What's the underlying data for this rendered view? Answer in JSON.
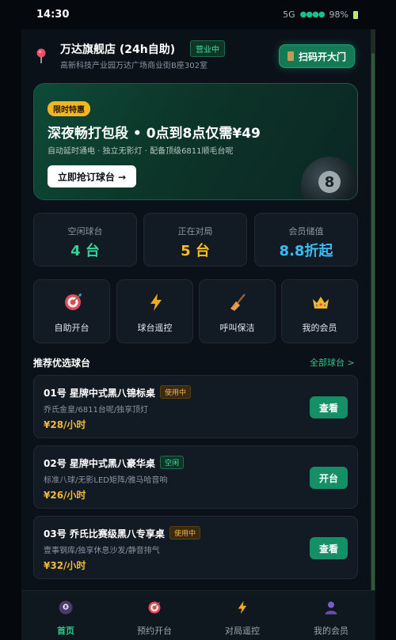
{
  "status": {
    "time": "14:30",
    "network": "5G",
    "signal": "●●●●",
    "battery": "98%"
  },
  "store": {
    "name": "万达旗舰店 (24h自助)",
    "open_badge": "营业中",
    "address": "高新科技产业园万达广场商业街B座302室",
    "scan_button": "扫码开大门"
  },
  "promo": {
    "tag": "限时特惠",
    "title": "深夜畅打包段 • 0点到8点仅需¥49",
    "subtitle": "自动延时通电 · 独立无影灯 · 配备顶级6811顺毛台呢",
    "button": "立即抢订球台 →",
    "ball_number": "8"
  },
  "stats": [
    {
      "label": "空闲球台",
      "value": "4 台",
      "color": "#34d399"
    },
    {
      "label": "正在对局",
      "value": "5 台",
      "color": "#fbbf24"
    },
    {
      "label": "会员储值",
      "value": "8.8折起",
      "color": "#38bdf8"
    }
  ],
  "actions": [
    {
      "label": "自助开台",
      "icon": "target-icon"
    },
    {
      "label": "球台遥控",
      "icon": "lightning-icon"
    },
    {
      "label": "呼叫保洁",
      "icon": "broom-icon"
    },
    {
      "label": "我的会员",
      "icon": "crown-icon"
    }
  ],
  "section": {
    "title": "推荐优选球台",
    "more": "全部球台 >"
  },
  "tables": [
    {
      "name": "01号 星牌中式黑八锦标桌",
      "status": "使用中",
      "status_type": "busy",
      "desc": "乔氏金皇/6811台呢/独享顶灯",
      "price": "¥28/小时",
      "button": "查看"
    },
    {
      "name": "02号 星牌中式黑八豪华桌",
      "status": "空闲",
      "status_type": "free",
      "desc": "标准八球/无影LED矩阵/雅马哈音响",
      "price": "¥26/小时",
      "button": "开台"
    },
    {
      "name": "03号 乔氏比赛级黑八专享桌",
      "status": "使用中",
      "status_type": "busy",
      "desc": "壹事钢库/独享休息沙发/静音排气",
      "price": "¥32/小时",
      "button": "查看"
    }
  ],
  "tabs": [
    {
      "label": "首页",
      "icon": "billiard-ball-icon",
      "active": true
    },
    {
      "label": "预约开台",
      "icon": "target-icon",
      "active": false
    },
    {
      "label": "对局遥控",
      "icon": "lightning-icon",
      "active": false
    },
    {
      "label": "我的会员",
      "icon": "user-icon",
      "active": false
    }
  ]
}
